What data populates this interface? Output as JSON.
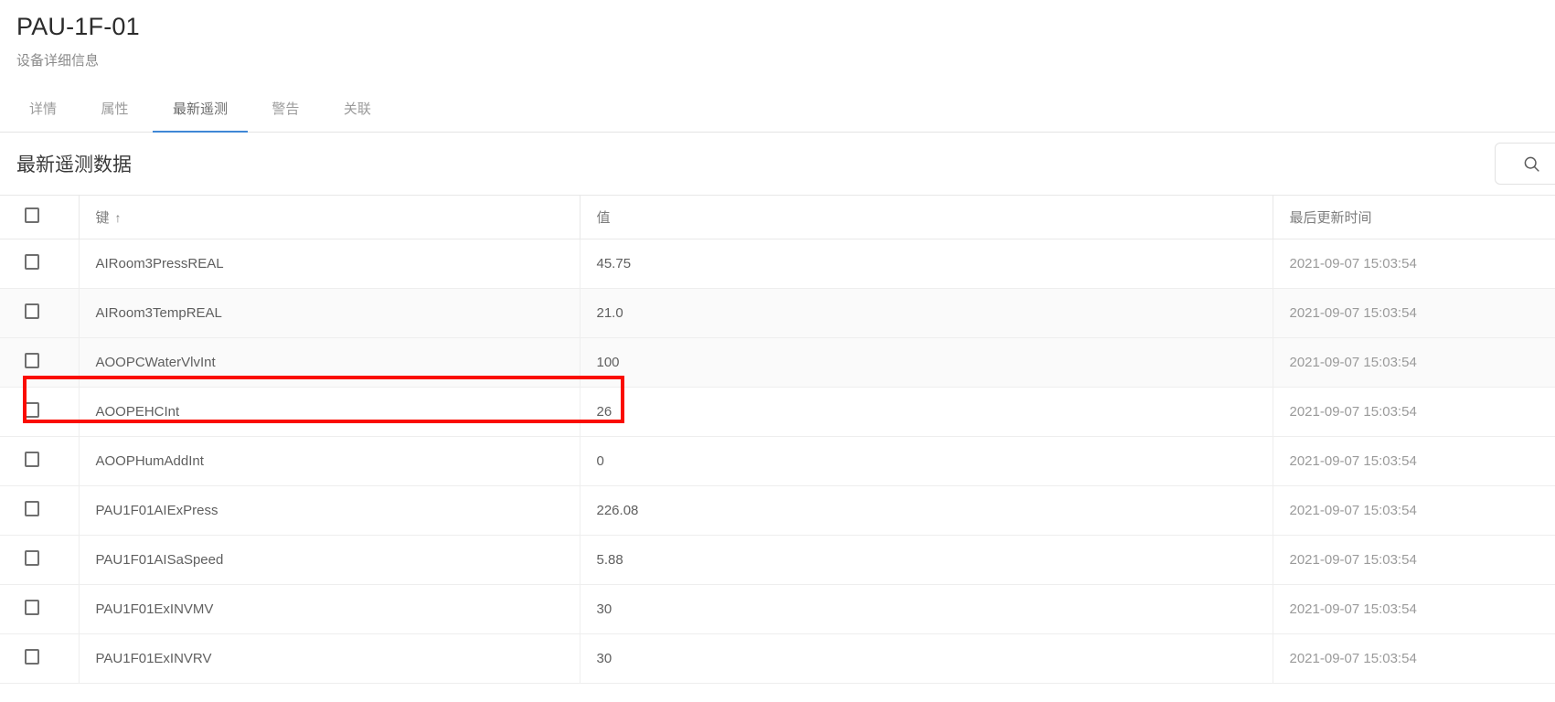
{
  "header": {
    "title": "PAU-1F-01",
    "subtitle": "设备详细信息"
  },
  "tabs": [
    {
      "label": "详情",
      "active": false
    },
    {
      "label": "属性",
      "active": false
    },
    {
      "label": "最新遥测",
      "active": true
    },
    {
      "label": "警告",
      "active": false
    },
    {
      "label": "关联",
      "active": false
    }
  ],
  "card": {
    "title": "最新遥测数据",
    "search_icon": "search-icon"
  },
  "table": {
    "columns": {
      "select": "",
      "key": "键",
      "sort_arrow": "↑",
      "value": "值",
      "last_update": "最后更新时间"
    },
    "rows": [
      {
        "key": "AIRoom3PressREAL",
        "value": "45.75",
        "time": "2021-09-07 15:03:54"
      },
      {
        "key": "AIRoom3TempREAL",
        "value": "21.0",
        "time": "2021-09-07 15:03:54"
      },
      {
        "key": "AOOPCWaterVlvInt",
        "value": "100",
        "time": "2021-09-07 15:03:54"
      },
      {
        "key": "AOOPEHCInt",
        "value": "26",
        "time": "2021-09-07 15:03:54"
      },
      {
        "key": "AOOPHumAddInt",
        "value": "0",
        "time": "2021-09-07 15:03:54"
      },
      {
        "key": "PAU1F01AIExPress",
        "value": "226.08",
        "time": "2021-09-07 15:03:54"
      },
      {
        "key": "PAU1F01AISaSpeed",
        "value": "5.88",
        "time": "2021-09-07 15:03:54"
      },
      {
        "key": "PAU1F01ExINVMV",
        "value": "30",
        "time": "2021-09-07 15:03:54"
      },
      {
        "key": "PAU1F01ExINVRV",
        "value": "30",
        "time": "2021-09-07 15:03:54"
      }
    ]
  },
  "annotation": {
    "highlight_color": "#fa0c00",
    "highlighted_row_key": "AOOPEHCInt"
  },
  "colors": {
    "accent": "#3f87d6",
    "text": "#5f5f5f",
    "muted": "#9a9a9a"
  }
}
